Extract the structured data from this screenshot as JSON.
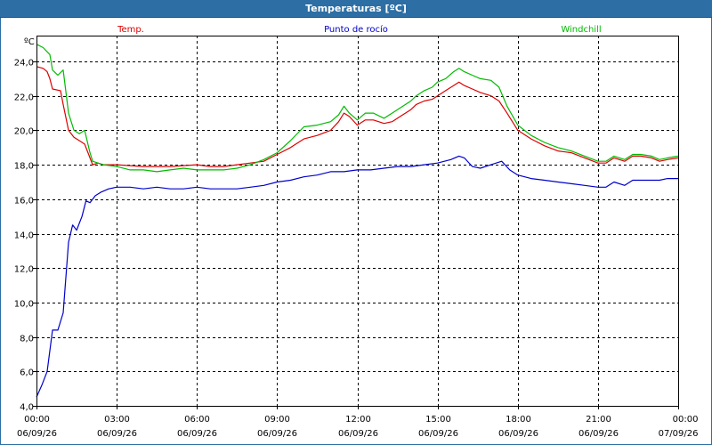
{
  "window": {
    "title": "Temperaturas [ºC]"
  },
  "chart_data": {
    "type": "line",
    "unit_label": "ºC",
    "ylim": [
      4,
      25.5
    ],
    "yticks": [
      "4,0",
      "6,0",
      "8,0",
      "10,0",
      "12,0",
      "14,0",
      "16,0",
      "18,0",
      "20,0",
      "22,0",
      "24,0"
    ],
    "ytick_values": [
      4,
      6,
      8,
      10,
      12,
      14,
      16,
      18,
      20,
      22,
      24
    ],
    "x_range": [
      0,
      24
    ],
    "xticks": [
      {
        "time": "00:00",
        "date": "06/09/26"
      },
      {
        "time": "03:00",
        "date": "06/09/26"
      },
      {
        "time": "06:00",
        "date": "06/09/26"
      },
      {
        "time": "09:00",
        "date": "06/09/26"
      },
      {
        "time": "12:00",
        "date": "06/09/26"
      },
      {
        "time": "15:00",
        "date": "06/09/26"
      },
      {
        "time": "18:00",
        "date": "06/09/26"
      },
      {
        "time": "21:00",
        "date": "06/09/26"
      },
      {
        "time": "00:00",
        "date": "07/09/26"
      }
    ],
    "grid": true,
    "legend_position": "top",
    "series": [
      {
        "name": "Temp.",
        "color": "#dd0000",
        "points": [
          [
            0,
            23.7
          ],
          [
            0.25,
            23.6
          ],
          [
            0.4,
            23.4
          ],
          [
            0.5,
            23.0
          ],
          [
            0.6,
            22.4
          ],
          [
            0.9,
            22.3
          ],
          [
            1.0,
            21.5
          ],
          [
            1.2,
            20.0
          ],
          [
            1.4,
            19.6
          ],
          [
            1.6,
            19.4
          ],
          [
            1.8,
            19.2
          ],
          [
            2.0,
            18.4
          ],
          [
            2.1,
            18.0
          ],
          [
            2.3,
            18.1
          ],
          [
            2.5,
            18.0
          ],
          [
            3,
            18.0
          ],
          [
            3.5,
            17.95
          ],
          [
            4,
            17.9
          ],
          [
            4.5,
            17.9
          ],
          [
            5,
            17.9
          ],
          [
            5.5,
            17.95
          ],
          [
            6,
            18.0
          ],
          [
            6.5,
            17.9
          ],
          [
            7,
            17.9
          ],
          [
            7.5,
            18.0
          ],
          [
            8,
            18.1
          ],
          [
            8.5,
            18.2
          ],
          [
            9,
            18.6
          ],
          [
            9.5,
            19.0
          ],
          [
            10,
            19.5
          ],
          [
            10.5,
            19.7
          ],
          [
            11,
            20.0
          ],
          [
            11.3,
            20.5
          ],
          [
            11.5,
            21.0
          ],
          [
            11.7,
            20.8
          ],
          [
            12,
            20.3
          ],
          [
            12.3,
            20.6
          ],
          [
            12.6,
            20.6
          ],
          [
            13,
            20.4
          ],
          [
            13.3,
            20.5
          ],
          [
            13.6,
            20.8
          ],
          [
            14,
            21.2
          ],
          [
            14.2,
            21.5
          ],
          [
            14.5,
            21.7
          ],
          [
            14.8,
            21.8
          ],
          [
            15,
            22.0
          ],
          [
            15.3,
            22.3
          ],
          [
            15.6,
            22.6
          ],
          [
            15.8,
            22.8
          ],
          [
            16,
            22.6
          ],
          [
            16.3,
            22.4
          ],
          [
            16.6,
            22.2
          ],
          [
            17,
            22.0
          ],
          [
            17.3,
            21.7
          ],
          [
            17.6,
            21.0
          ],
          [
            18,
            20.0
          ],
          [
            18.5,
            19.5
          ],
          [
            19,
            19.1
          ],
          [
            19.5,
            18.8
          ],
          [
            20,
            18.7
          ],
          [
            20.5,
            18.4
          ],
          [
            21,
            18.1
          ],
          [
            21.3,
            18.1
          ],
          [
            21.6,
            18.4
          ],
          [
            22,
            18.2
          ],
          [
            22.3,
            18.5
          ],
          [
            22.6,
            18.5
          ],
          [
            23,
            18.4
          ],
          [
            23.3,
            18.2
          ],
          [
            23.6,
            18.3
          ],
          [
            24,
            18.4
          ]
        ]
      },
      {
        "name": "Punto de rocío",
        "color": "#0000cc",
        "points": [
          [
            0,
            4.5
          ],
          [
            0.2,
            5.2
          ],
          [
            0.4,
            6.0
          ],
          [
            0.6,
            8.4
          ],
          [
            0.8,
            8.4
          ],
          [
            1.0,
            9.4
          ],
          [
            1.2,
            13.5
          ],
          [
            1.35,
            14.5
          ],
          [
            1.5,
            14.2
          ],
          [
            1.7,
            15.0
          ],
          [
            1.85,
            15.9
          ],
          [
            2.0,
            15.8
          ],
          [
            2.2,
            16.2
          ],
          [
            2.4,
            16.4
          ],
          [
            2.7,
            16.6
          ],
          [
            3,
            16.7
          ],
          [
            3.5,
            16.7
          ],
          [
            4,
            16.6
          ],
          [
            4.5,
            16.7
          ],
          [
            5,
            16.6
          ],
          [
            5.5,
            16.6
          ],
          [
            6,
            16.7
          ],
          [
            6.5,
            16.6
          ],
          [
            7,
            16.6
          ],
          [
            7.5,
            16.6
          ],
          [
            8,
            16.7
          ],
          [
            8.5,
            16.8
          ],
          [
            9,
            17.0
          ],
          [
            9.5,
            17.1
          ],
          [
            10,
            17.3
          ],
          [
            10.5,
            17.4
          ],
          [
            11,
            17.6
          ],
          [
            11.5,
            17.6
          ],
          [
            12,
            17.7
          ],
          [
            12.5,
            17.7
          ],
          [
            13,
            17.8
          ],
          [
            13.5,
            17.9
          ],
          [
            14,
            17.9
          ],
          [
            14.5,
            18.0
          ],
          [
            15,
            18.1
          ],
          [
            15.5,
            18.3
          ],
          [
            15.8,
            18.5
          ],
          [
            16,
            18.4
          ],
          [
            16.3,
            17.9
          ],
          [
            16.6,
            17.8
          ],
          [
            17,
            18.0
          ],
          [
            17.4,
            18.2
          ],
          [
            17.7,
            17.7
          ],
          [
            18,
            17.4
          ],
          [
            18.5,
            17.2
          ],
          [
            19,
            17.1
          ],
          [
            19.5,
            17.0
          ],
          [
            20,
            16.9
          ],
          [
            20.5,
            16.8
          ],
          [
            21,
            16.7
          ],
          [
            21.3,
            16.7
          ],
          [
            21.6,
            17.0
          ],
          [
            22,
            16.8
          ],
          [
            22.3,
            17.1
          ],
          [
            22.6,
            17.1
          ],
          [
            23,
            17.1
          ],
          [
            23.3,
            17.1
          ],
          [
            23.6,
            17.2
          ],
          [
            24,
            17.2
          ]
        ]
      },
      {
        "name": "Windchill",
        "color": "#00bb00",
        "points": [
          [
            0,
            25.0
          ],
          [
            0.25,
            24.8
          ],
          [
            0.5,
            24.4
          ],
          [
            0.6,
            23.5
          ],
          [
            0.8,
            23.2
          ],
          [
            1.0,
            23.5
          ],
          [
            1.2,
            21.0
          ],
          [
            1.4,
            20.0
          ],
          [
            1.6,
            19.8
          ],
          [
            1.8,
            20.0
          ],
          [
            2.0,
            18.7
          ],
          [
            2.1,
            18.2
          ],
          [
            2.3,
            18.1
          ],
          [
            2.5,
            18.0
          ],
          [
            3,
            17.9
          ],
          [
            3.5,
            17.7
          ],
          [
            4,
            17.7
          ],
          [
            4.5,
            17.6
          ],
          [
            5,
            17.7
          ],
          [
            5.5,
            17.8
          ],
          [
            6,
            17.7
          ],
          [
            6.5,
            17.7
          ],
          [
            7,
            17.7
          ],
          [
            7.5,
            17.8
          ],
          [
            8,
            18.0
          ],
          [
            8.5,
            18.3
          ],
          [
            9,
            18.7
          ],
          [
            9.5,
            19.4
          ],
          [
            10,
            20.2
          ],
          [
            10.5,
            20.3
          ],
          [
            11,
            20.5
          ],
          [
            11.3,
            20.9
          ],
          [
            11.5,
            21.4
          ],
          [
            11.7,
            21.0
          ],
          [
            12,
            20.6
          ],
          [
            12.3,
            21.0
          ],
          [
            12.6,
            21.0
          ],
          [
            13,
            20.7
          ],
          [
            13.3,
            21.0
          ],
          [
            13.6,
            21.3
          ],
          [
            14,
            21.7
          ],
          [
            14.2,
            22.0
          ],
          [
            14.5,
            22.3
          ],
          [
            14.8,
            22.5
          ],
          [
            15,
            22.8
          ],
          [
            15.3,
            23.0
          ],
          [
            15.6,
            23.4
          ],
          [
            15.8,
            23.6
          ],
          [
            16,
            23.4
          ],
          [
            16.3,
            23.2
          ],
          [
            16.6,
            23.0
          ],
          [
            17,
            22.9
          ],
          [
            17.3,
            22.5
          ],
          [
            17.6,
            21.4
          ],
          [
            18,
            20.3
          ],
          [
            18.5,
            19.7
          ],
          [
            19,
            19.3
          ],
          [
            19.5,
            19.0
          ],
          [
            20,
            18.8
          ],
          [
            20.5,
            18.5
          ],
          [
            21,
            18.2
          ],
          [
            21.3,
            18.2
          ],
          [
            21.6,
            18.5
          ],
          [
            22,
            18.3
          ],
          [
            22.3,
            18.6
          ],
          [
            22.6,
            18.6
          ],
          [
            23,
            18.5
          ],
          [
            23.3,
            18.3
          ],
          [
            23.6,
            18.4
          ],
          [
            24,
            18.5
          ]
        ]
      }
    ]
  }
}
